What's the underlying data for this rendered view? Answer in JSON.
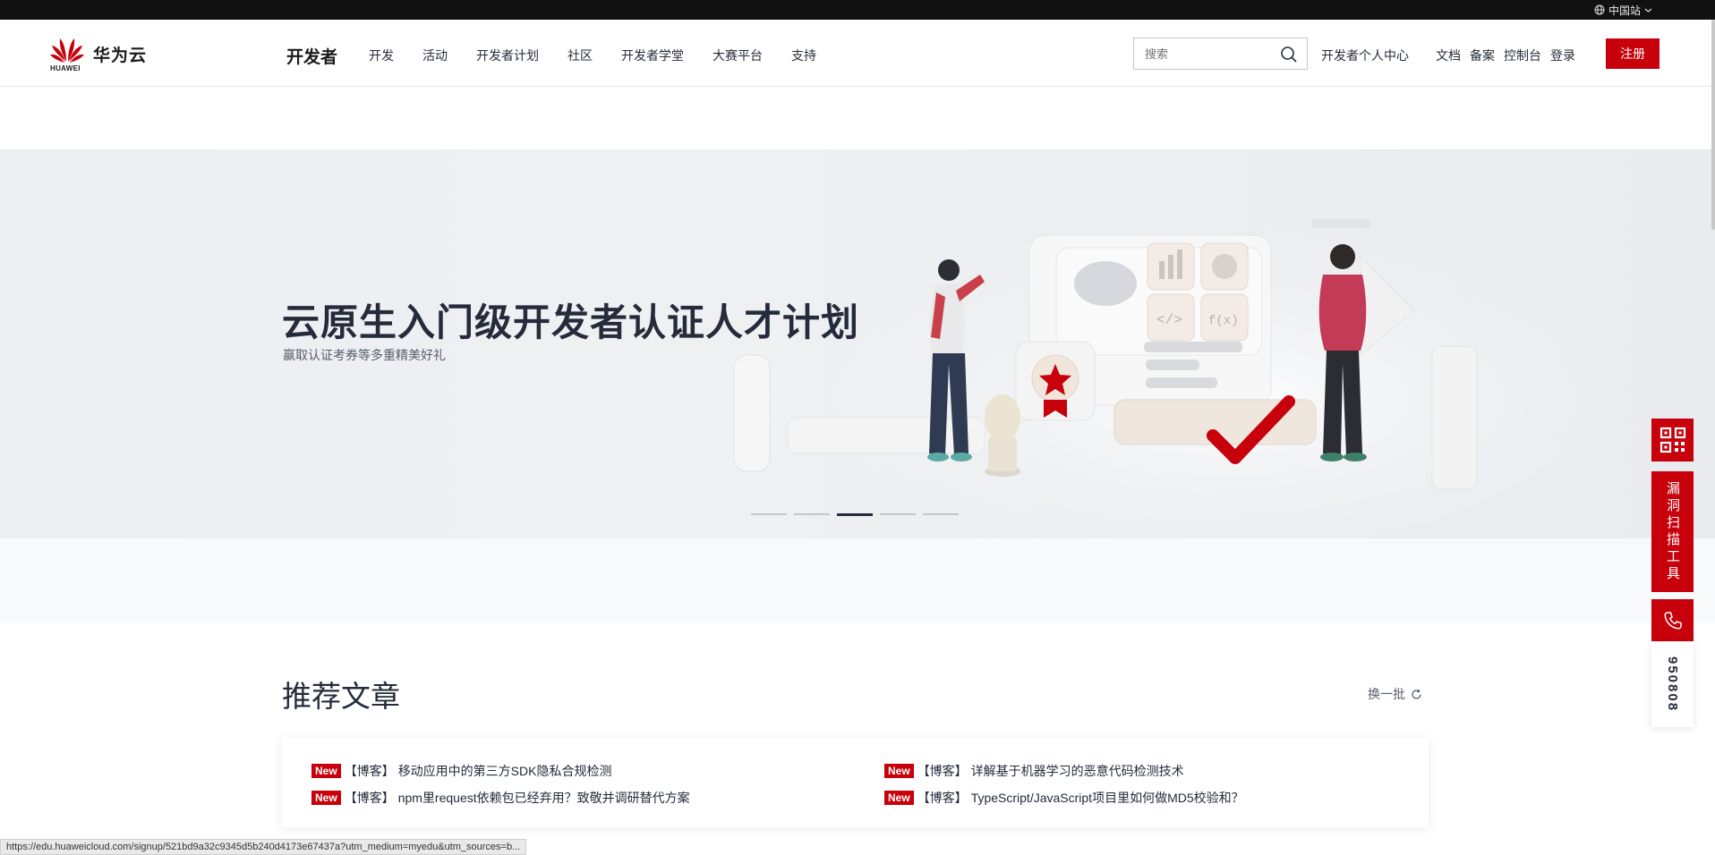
{
  "topbar": {
    "region_label": "中国站"
  },
  "header": {
    "logo_text": "华为云",
    "logo_sub": "HUAWEI",
    "nav_title": "开发者",
    "nav_items": [
      {
        "label": "开发"
      },
      {
        "label": "活动"
      },
      {
        "label": "开发者计划"
      },
      {
        "label": "社区"
      },
      {
        "label": "开发者学堂"
      },
      {
        "label": "大赛平台"
      },
      {
        "label": "支持"
      }
    ],
    "search_placeholder": "搜索",
    "right_links": {
      "personal_center": "开发者个人中心",
      "docs": "文档",
      "filing": "备案",
      "console": "控制台",
      "login": "登录"
    },
    "register_label": "注册"
  },
  "banner": {
    "title": "云原生入门级开发者认证人才计划",
    "subtitle": "赢取认证考券等多重精美好礼",
    "slide_count": 5,
    "active_slide": 3
  },
  "recommended": {
    "title": "推荐文章",
    "refresh_label": "换一批",
    "articles": [
      {
        "tag": "New",
        "category": "【博客】",
        "title": "移动应用中的第三方SDK隐私合规检测"
      },
      {
        "tag": "New",
        "category": "【博客】",
        "title": "npm里request依赖包已经弃用？致敬并调研替代方案"
      },
      {
        "tag": "New",
        "category": "【博客】",
        "title": "详解基于机器学习的恶意代码检测技术"
      },
      {
        "tag": "New",
        "category": "【博客】",
        "title": "TypeScript/JavaScript项目里如何做MD5校验和？"
      }
    ]
  },
  "floating": {
    "scan_tool_label": "漏洞扫描工具",
    "phone_number": "950808"
  },
  "status_url": "https://edu.huaweicloud.com/signup/521bd9a32c9345d5b240d4173e67437a?utm_medium=myedu&utm_sources=b...",
  "colors": {
    "brand_red": "#c7000b",
    "text_dark": "#252b3a"
  }
}
